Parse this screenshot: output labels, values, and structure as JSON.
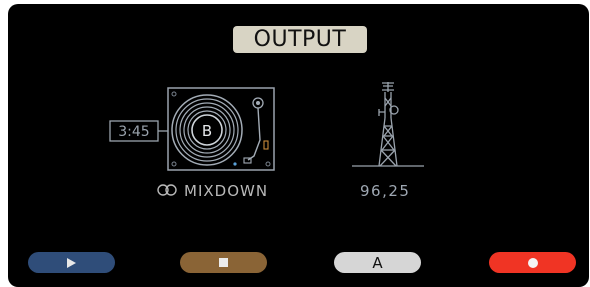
{
  "header": {
    "title": "OUTPUT"
  },
  "turntable": {
    "time": "3:45",
    "deck_letter": "B"
  },
  "mixdown": {
    "label": "MIXDOWN",
    "icon": "link-rings-icon"
  },
  "broadcast": {
    "frequency": "96,25",
    "icon": "radio-tower-icon"
  },
  "controls": {
    "play_icon": "play-icon",
    "stop_icon": "stop-icon",
    "a_label": "A",
    "record_icon": "record-icon"
  },
  "colors": {
    "title_bg": "#d8d4c4",
    "play": "#2f4d79",
    "stop": "#8a6436",
    "a": "#d6d6d6",
    "record": "#f03424",
    "line_art": "#8c96a3"
  }
}
